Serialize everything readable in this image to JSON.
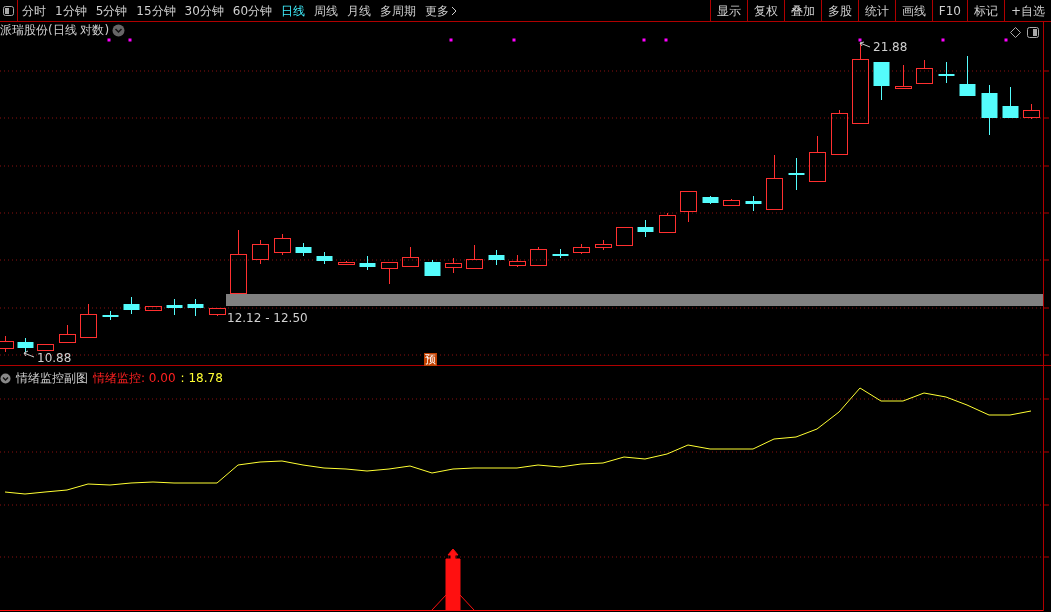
{
  "toolbar": {
    "periods": [
      {
        "label": "分时",
        "selected": false
      },
      {
        "label": "1分钟",
        "selected": false
      },
      {
        "label": "5分钟",
        "selected": false
      },
      {
        "label": "15分钟",
        "selected": false
      },
      {
        "label": "30分钟",
        "selected": false
      },
      {
        "label": "60分钟",
        "selected": false
      },
      {
        "label": "日线",
        "selected": true
      },
      {
        "label": "周线",
        "selected": false
      },
      {
        "label": "月线",
        "selected": false
      },
      {
        "label": "多周期",
        "selected": false
      }
    ],
    "more": "更多",
    "buttons": [
      "显示",
      "复权",
      "叠加",
      "多股",
      "统计",
      "画线",
      "F10",
      "标记",
      "+自选"
    ]
  },
  "chart": {
    "title": "派瑞股份(日线 对数)",
    "high_label": "21.88",
    "low_label": "10.88",
    "range_label": "12.12 - 12.50",
    "badge": "预"
  },
  "indicator": {
    "title": "情绪监控副图",
    "readings": [
      {
        "text": "情绪监控: 0.00",
        "color": "#ff2020"
      },
      {
        "text": ": 18.78",
        "color": "#ffff33"
      }
    ]
  }
}
